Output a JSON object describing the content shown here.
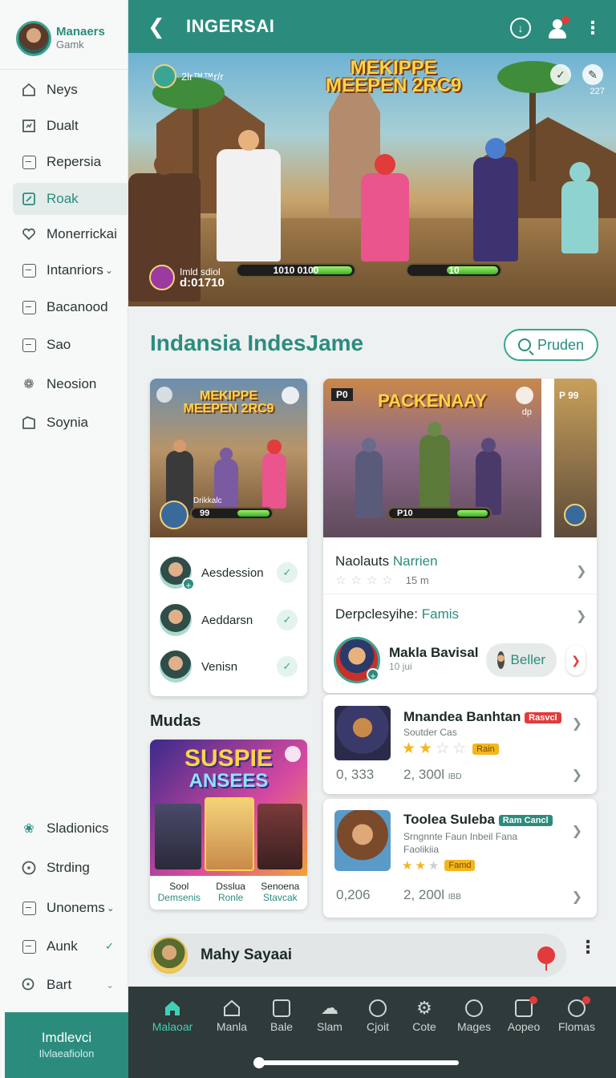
{
  "sidebar": {
    "profile": {
      "name": "Manaers",
      "subtitle": "Gamk"
    },
    "items": [
      {
        "label": "Neys",
        "icon": "home-icon"
      },
      {
        "label": "Dualt",
        "icon": "chart-icon"
      },
      {
        "label": "Repersia",
        "icon": "document-icon"
      },
      {
        "label": "Roak",
        "icon": "edit-icon"
      },
      {
        "label": "Monerrickai",
        "icon": "heart-icon"
      },
      {
        "label": "Intanriors",
        "icon": "info-icon"
      },
      {
        "label": "Bacanood",
        "icon": "list-icon"
      },
      {
        "label": "Sao",
        "icon": "minus-box-icon"
      },
      {
        "label": "Neosion",
        "icon": "gear-icon"
      },
      {
        "label": "Soynia",
        "icon": "folder-icon"
      }
    ],
    "lower_items": [
      {
        "label": "Sladionics",
        "icon": "flower-icon"
      },
      {
        "label": "Strding",
        "icon": "circle-icon"
      },
      {
        "label": "Unonems",
        "icon": "info-icon"
      },
      {
        "label": "Aunk",
        "icon": "chart-icon"
      },
      {
        "label": "Bart",
        "icon": "search-icon"
      }
    ],
    "footer": {
      "title": "Imdlevci",
      "subtitle": "Ilvlaeafiolon"
    }
  },
  "topbar": {
    "title": "INGERSAI"
  },
  "hero": {
    "game_title_line1": "MEKIPPE",
    "game_title_line2": "MEEPEN 2RC9",
    "top_left_text": "2lr™™r/r",
    "top_right_sub": "227",
    "bottom_left_line1": "Imld sdiol",
    "bottom_left_line2": "d:01710",
    "bar1_label": "1010 0100",
    "bar2_label": "10",
    "bar1_fill": 0.35,
    "bar2_fill": 0.55
  },
  "section": {
    "title": "Indansia IndesJame",
    "search_label": "Pruden"
  },
  "card1": {
    "thumb_title_1": "MEKIPPE",
    "thumb_title_2": "MEEPEN 2RC9",
    "thumb_sub": "Drikkalc",
    "bar_label": "99",
    "people": [
      {
        "name": "Aesdession"
      },
      {
        "name": "Aeddarsn"
      },
      {
        "name": "Venisn"
      }
    ]
  },
  "card2": {
    "thumb_title": "PACKENAAY",
    "thumb_tl": "P0",
    "thumb_tr": "dp",
    "bar_label": "P10",
    "thumb3_label": "P 99",
    "row1_a": "Naolauts",
    "row1_b": "Narrien",
    "row1_meta": "15 m",
    "row2_a": "Derpclesyihe:",
    "row2_b": "Famis",
    "user_name": "Makla Bavisal",
    "user_meta": "10 jui",
    "follow_label": "Beller"
  },
  "mudas": {
    "title": "Mudas",
    "banner_line1": "SUSPIE",
    "banner_line2": "ANSEES",
    "labels": [
      {
        "top": "Sool",
        "bottom": "Demsenis"
      },
      {
        "top": "Dsslua",
        "bottom": "Ronle"
      },
      {
        "top": "Senoena",
        "bottom": "Stavcak"
      }
    ]
  },
  "list": [
    {
      "title": "Mnandea Banhtan",
      "tag": "Rasvcl",
      "tag_color": "#e23b3b",
      "subtitle": "Soutder Cas",
      "rating": 2,
      "chip": "Rain",
      "stat1": "0, 333",
      "stat2": "2, 300l",
      "stat2_unit": "IBD"
    },
    {
      "title": "Toolea Suleba",
      "tag": "Ram Cancl",
      "tag_color": "#2b8c7e",
      "subtitle": "Srngnnte Faun Inbeil Fana",
      "subtitle2": "Faolikiia",
      "rating": 2,
      "chip": "Famd",
      "stat1": "0,206",
      "stat2": "2, 200l",
      "stat2_unit": "IBB"
    }
  ],
  "player": {
    "name": "Mahy Sayaai"
  },
  "tabbar": [
    {
      "label": "Malaoar",
      "icon": "home-icon"
    },
    {
      "label": "Manla",
      "icon": "home-outline-icon"
    },
    {
      "label": "Bale",
      "icon": "image-icon"
    },
    {
      "label": "Slam",
      "icon": "cloud-icon"
    },
    {
      "label": "Cjoit",
      "icon": "user-icon"
    },
    {
      "label": "Cote",
      "icon": "gear-icon"
    },
    {
      "label": "Mages",
      "icon": "search-icon"
    },
    {
      "label": "Aopeo",
      "icon": "bell-icon"
    },
    {
      "label": "Flomas",
      "icon": "people-icon"
    }
  ]
}
